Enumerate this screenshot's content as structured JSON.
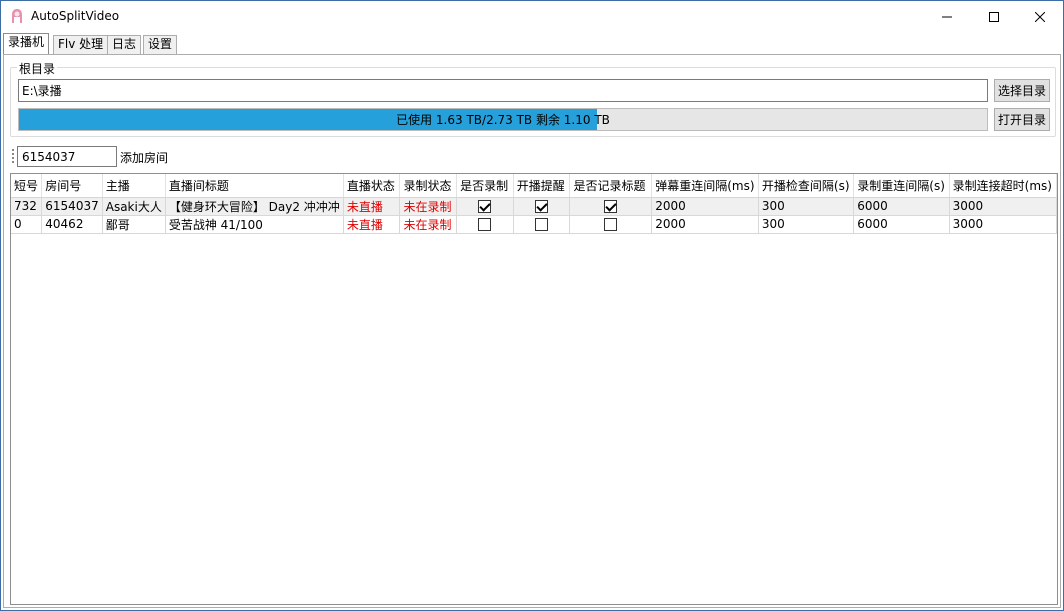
{
  "window": {
    "title": "AutoSplitVideo",
    "icon": "app-pink-icon"
  },
  "tabs": [
    "录播机",
    "Flv 处理",
    "日志",
    "设置"
  ],
  "root_dir": {
    "group_label": "根目录",
    "path": "E:\\录播",
    "choose_button": "选择目录",
    "open_button": "打开目录",
    "usage_text": "已使用 1.63 TB/2.73 TB 剩余 1.10 TB",
    "usage_fraction": 0.597,
    "fill_color": "#26a0da"
  },
  "add_room": {
    "value": "6154037",
    "label": "添加房间"
  },
  "table": {
    "headers": [
      "短号",
      "房间号",
      "主播",
      "直播间标题",
      "直播状态",
      "录制状态",
      "是否录制",
      "开播提醒",
      "是否记录标题",
      "弹幕重连间隔(ms)",
      "开播检查间隔(s)",
      "录制重连间隔(s)",
      "录制连接超时(ms)"
    ],
    "rows": [
      {
        "short_id": "732",
        "room_id": "6154037",
        "host": "Asaki大人",
        "title": "【健身环大冒险】 Day2 冲冲冲",
        "live_status": "未直播",
        "record_status": "未在录制",
        "record": true,
        "notify": true,
        "log_title": true,
        "danmaku_reconnect": "2000",
        "live_check": "300",
        "record_reconnect": "6000",
        "record_timeout": "3000"
      },
      {
        "short_id": "0",
        "room_id": "40462",
        "host": "鄙哥",
        "title": "受苦战神 41/100",
        "live_status": "未直播",
        "record_status": "未在录制",
        "record": false,
        "notify": false,
        "log_title": false,
        "danmaku_reconnect": "2000",
        "live_check": "300",
        "record_reconnect": "6000",
        "record_timeout": "3000"
      }
    ]
  }
}
